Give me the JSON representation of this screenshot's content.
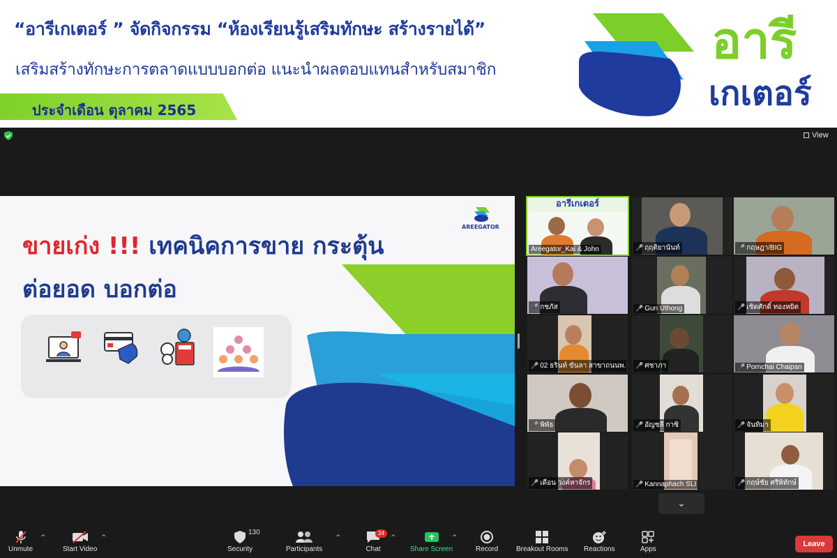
{
  "banner": {
    "headline": "“อารีเกเตอร์ ” จัดกิจกรรม “ห้องเรียนรู้เสริมทักษะ สร้างรายได้”",
    "subline": "เสริมสร้างทักษะการตลาดแบบบอกต่อ แนะนำผลตอบแทนสำหรับสมาชิก",
    "date": "ประจำเดือน ตุลาคม 2565",
    "brand_line1": "อารี",
    "brand_line2": "เกเตอร์",
    "colors": {
      "navy": "#1f3b9e",
      "green": "#7ccf2a",
      "blue": "#1aa0e6"
    }
  },
  "zoom": {
    "view_label": "View",
    "shared_slide": {
      "title_red": "ขายเก่ง !!!",
      "title_rest": " เทคนิคการขาย กระตุ้น",
      "title_line2": "ต่อยอด บอกต่อ",
      "brand": "AREEGATOR",
      "icons": [
        "online-consult-icon",
        "card-payment-icon",
        "money-calculator-icon",
        "team-network-icon"
      ]
    },
    "participants": [
      "Areegator_Kai & John",
      "ฤฤติยานันท์",
      "กฤษฎา/BIG",
      "กชภัส",
      "Gun Uthong",
      "เชิดศักดิ์ ทองหยิต",
      "02 ธรินท์ ขันลา สาขาถนนพ...",
      "ศชาภา",
      "Pornchai Chaipan",
      "พิพัธ",
      "อัญชลี กาซิ",
      "จันทิมา",
      "เดือน วงค์หาจักร",
      "Kannaphach SLI",
      "กฤษ์ชัย ศรีพิทักษ์"
    ],
    "toolbar": {
      "unmute": "Unmute",
      "start_video": "Start Video",
      "security": "Security",
      "security_count": "130",
      "participants": "Participants",
      "chat": "Chat",
      "chat_badge": "24",
      "share_screen": "Share Screen",
      "record": "Record",
      "breakout_rooms": "Breakout Rooms",
      "reactions": "Reactions",
      "apps": "Apps",
      "leave": "Leave"
    }
  }
}
